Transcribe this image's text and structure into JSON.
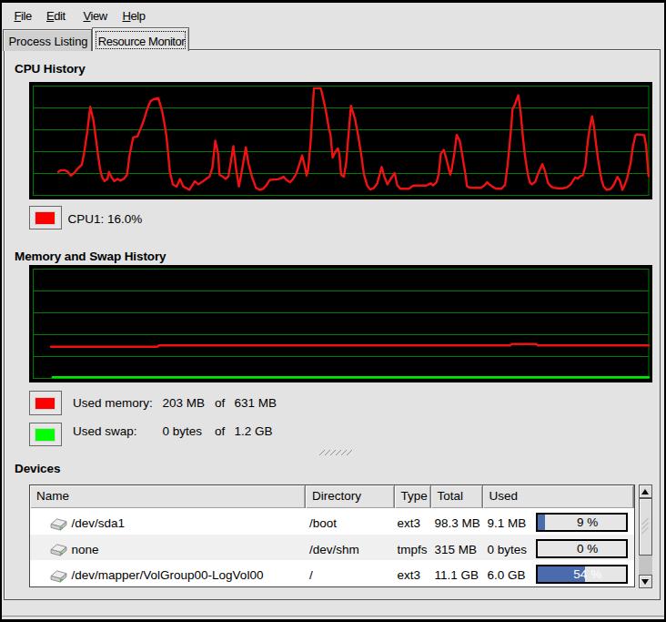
{
  "menu": {
    "items": [
      {
        "label": "File"
      },
      {
        "label": "Edit"
      },
      {
        "label": "View"
      },
      {
        "label": "Help"
      }
    ]
  },
  "tabs": [
    {
      "label": "Process Listing",
      "active": false
    },
    {
      "label": "Resource Monitor",
      "active": true
    }
  ],
  "cpu": {
    "heading": "CPU History",
    "legend": {
      "label": "CPU1:",
      "value": "16.0%",
      "color": "#ff0000"
    }
  },
  "memory": {
    "heading": "Memory and Swap History",
    "legends": [
      {
        "label": "Used memory:",
        "value": "203 MB",
        "of": "of",
        "total": "631 MB",
        "color": "#ff0000"
      },
      {
        "label": "Used swap:",
        "value": "0 bytes",
        "of": "of",
        "total": "1.2 GB",
        "color": "#00ff00"
      }
    ]
  },
  "devices": {
    "heading": "Devices",
    "columns": [
      {
        "label": "Name"
      },
      {
        "label": "Directory"
      },
      {
        "label": "Type"
      },
      {
        "label": "Total"
      },
      {
        "label": "Used"
      }
    ],
    "rows": [
      {
        "name": "/dev/sda1",
        "directory": "/boot",
        "type": "ext3",
        "total": "98.3 MB",
        "used": "9.1 MB",
        "percent": 9,
        "percent_label": "9 %"
      },
      {
        "name": "none",
        "directory": "/dev/shm",
        "type": "tmpfs",
        "total": "315 MB",
        "used": "0 bytes",
        "percent": 0,
        "percent_label": "0 %"
      },
      {
        "name": "/dev/mapper/VolGroup00-LogVol00",
        "directory": "/",
        "type": "ext3",
        "total": "11.1 GB",
        "used": "6.0 GB",
        "percent": 54,
        "percent_label": "54 %"
      }
    ]
  },
  "icons": {
    "device_row_icon": "harddisk-icon",
    "scrollbar_icons": [
      "scroll-up-icon",
      "scroll-down-icon"
    ],
    "grip_icon": "pane-resize-grip"
  },
  "colors": {
    "window_bg": "#dcdcdc",
    "chart_bg": "#000000",
    "grid_green": "#007d00",
    "cpu_line": "#f01212",
    "mem_line": "#f01212",
    "swap_line": "#00e800",
    "progress_blue": "#4a6cad",
    "alt_row": "#efefef"
  },
  "chart_data": [
    {
      "type": "line",
      "title": "CPU History",
      "xlabel": "",
      "ylabel": "",
      "ylim": [
        0,
        100
      ],
      "grid": true,
      "h_gridlines": 4,
      "grid_color": "#007d00",
      "bg": "#000000",
      "legend_position": "below",
      "series": [
        {
          "name": "CPU1",
          "color": "#f01212",
          "width": 2.4,
          "current_value_label": "16.0%",
          "points": [
            [
              0.0406,
              21.5
            ],
            [
              0.045,
              23
            ],
            [
              0.0509,
              23
            ],
            [
              0.0554,
              22
            ],
            [
              0.0613,
              18
            ],
            [
              0.0657,
              20
            ],
            [
              0.0731,
              25
            ],
            [
              0.079,
              28
            ],
            [
              0.0825,
              38
            ],
            [
              0.0878,
              58
            ],
            [
              0.0927,
              81
            ],
            [
              0.0977,
              69
            ],
            [
              0.1007,
              57
            ],
            [
              0.1051,
              38
            ],
            [
              0.1086,
              24
            ],
            [
              0.1116,
              17
            ],
            [
              0.1159,
              13
            ],
            [
              0.1206,
              15
            ],
            [
              0.1232,
              21.5
            ],
            [
              0.1268,
              17
            ],
            [
              0.1315,
              13
            ],
            [
              0.137,
              15
            ],
            [
              0.1413,
              13.5
            ],
            [
              0.1472,
              15
            ],
            [
              0.1525,
              19
            ],
            [
              0.1569,
              38
            ],
            [
              0.1624,
              53
            ],
            [
              0.1696,
              54
            ],
            [
              0.1714,
              57
            ],
            [
              0.1751,
              62
            ],
            [
              0.1805,
              70
            ],
            [
              0.1858,
              80
            ],
            [
              0.1906,
              86
            ],
            [
              0.1956,
              88
            ],
            [
              0.2032,
              89
            ],
            [
              0.2094,
              77
            ],
            [
              0.2131,
              66
            ],
            [
              0.2167,
              53
            ],
            [
              0.2221,
              21
            ],
            [
              0.2269,
              10
            ],
            [
              0.2331,
              8
            ],
            [
              0.2385,
              15
            ],
            [
              0.244,
              8
            ],
            [
              0.2493,
              6.5
            ],
            [
              0.2537,
              5
            ],
            [
              0.2627,
              13
            ],
            [
              0.2682,
              10
            ],
            [
              0.2737,
              12
            ],
            [
              0.2809,
              15
            ],
            [
              0.2863,
              17
            ],
            [
              0.2911,
              25
            ],
            [
              0.2958,
              50
            ],
            [
              0.3005,
              38
            ],
            [
              0.3026,
              19
            ],
            [
              0.308,
              17
            ],
            [
              0.3125,
              15
            ],
            [
              0.3172,
              17.5
            ],
            [
              0.3252,
              45
            ],
            [
              0.3299,
              23
            ],
            [
              0.3342,
              8
            ],
            [
              0.3379,
              19
            ],
            [
              0.3454,
              44
            ],
            [
              0.3498,
              29
            ],
            [
              0.3553,
              17
            ],
            [
              0.3618,
              7
            ],
            [
              0.368,
              5
            ],
            [
              0.3734,
              6
            ],
            [
              0.3787,
              9
            ],
            [
              0.3842,
              14
            ],
            [
              0.3897,
              14.5
            ],
            [
              0.3951,
              14.5
            ],
            [
              0.4024,
              15.5
            ],
            [
              0.4068,
              17
            ],
            [
              0.4115,
              14
            ],
            [
              0.417,
              12
            ],
            [
              0.4223,
              15
            ],
            [
              0.4277,
              20
            ],
            [
              0.4369,
              36.5
            ],
            [
              0.4415,
              26
            ],
            [
              0.4441,
              18
            ],
            [
              0.4466,
              23
            ],
            [
              0.4509,
              50
            ],
            [
              0.4539,
              80
            ],
            [
              0.4561,
              98
            ],
            [
              0.467,
              98
            ],
            [
              0.4695,
              93
            ],
            [
              0.475,
              79
            ],
            [
              0.4804,
              61
            ],
            [
              0.483,
              56
            ],
            [
              0.4852,
              42
            ],
            [
              0.4865,
              34.5
            ],
            [
              0.4912,
              40
            ],
            [
              0.4949,
              43
            ],
            [
              0.4974,
              38
            ],
            [
              0.5002,
              19
            ],
            [
              0.5046,
              17
            ],
            [
              0.5085,
              30
            ],
            [
              0.5129,
              60
            ],
            [
              0.5162,
              82
            ],
            [
              0.5228,
              70
            ],
            [
              0.5281,
              54
            ],
            [
              0.5328,
              38
            ],
            [
              0.5373,
              19
            ],
            [
              0.5427,
              9
            ],
            [
              0.5475,
              5.3
            ],
            [
              0.5535,
              6.7
            ],
            [
              0.559,
              11
            ],
            [
              0.5662,
              26
            ],
            [
              0.5706,
              17
            ],
            [
              0.5754,
              10
            ],
            [
              0.5808,
              15
            ],
            [
              0.5873,
              20.5
            ],
            [
              0.5916,
              9
            ],
            [
              0.597,
              6
            ],
            [
              0.603,
              6
            ],
            [
              0.6103,
              6
            ],
            [
              0.6177,
              9
            ],
            [
              0.6251,
              9
            ],
            [
              0.6316,
              9
            ],
            [
              0.6388,
              9
            ],
            [
              0.6461,
              11
            ],
            [
              0.6496,
              9
            ],
            [
              0.6551,
              12
            ],
            [
              0.6587,
              19
            ],
            [
              0.6623,
              38
            ],
            [
              0.6669,
              41.6
            ],
            [
              0.6722,
              31.5
            ],
            [
              0.6775,
              18.9
            ],
            [
              0.6797,
              23
            ],
            [
              0.6841,
              38
            ],
            [
              0.688,
              55.3
            ],
            [
              0.693,
              50
            ],
            [
              0.6968,
              37.6
            ],
            [
              0.7023,
              19
            ],
            [
              0.7046,
              8.4
            ],
            [
              0.7092,
              7
            ],
            [
              0.7166,
              6.8
            ],
            [
              0.7274,
              6.8
            ],
            [
              0.7328,
              9
            ],
            [
              0.7374,
              12
            ],
            [
              0.7421,
              9.5
            ],
            [
              0.7473,
              7.6
            ],
            [
              0.7523,
              6
            ],
            [
              0.7604,
              6
            ],
            [
              0.7666,
              9.5
            ],
            [
              0.7706,
              26.9
            ],
            [
              0.7739,
              45.4
            ],
            [
              0.7768,
              63.9
            ],
            [
              0.7787,
              78.9
            ],
            [
              0.7821,
              82.4
            ],
            [
              0.7849,
              87
            ],
            [
              0.7882,
              91.7
            ],
            [
              0.7919,
              76.6
            ],
            [
              0.7959,
              52
            ],
            [
              0.7987,
              37.5
            ],
            [
              0.8016,
              26.2
            ],
            [
              0.8044,
              17.3
            ],
            [
              0.8072,
              11.6
            ],
            [
              0.81,
              10
            ],
            [
              0.8158,
              12.5
            ],
            [
              0.8201,
              19.7
            ],
            [
              0.8272,
              28.6
            ],
            [
              0.8317,
              22
            ],
            [
              0.8362,
              11.5
            ],
            [
              0.8406,
              8.4
            ],
            [
              0.845,
              7
            ],
            [
              0.8524,
              6.5
            ],
            [
              0.8604,
              6.5
            ],
            [
              0.8664,
              7.2
            ],
            [
              0.8726,
              9.5
            ],
            [
              0.8766,
              13
            ],
            [
              0.8807,
              16.5
            ],
            [
              0.8849,
              15.3
            ],
            [
              0.8889,
              17.7
            ],
            [
              0.893,
              18.2
            ],
            [
              0.8971,
              26.9
            ],
            [
              0.9011,
              50
            ],
            [
              0.9045,
              62.7
            ],
            [
              0.908,
              72.4
            ],
            [
              0.9114,
              61.5
            ],
            [
              0.9142,
              47.7
            ],
            [
              0.9175,
              33.8
            ],
            [
              0.9207,
              22.2
            ],
            [
              0.9235,
              14.2
            ],
            [
              0.9265,
              8.4
            ],
            [
              0.9317,
              4.9
            ],
            [
              0.9379,
              6
            ],
            [
              0.942,
              8.4
            ],
            [
              0.946,
              13
            ],
            [
              0.9492,
              16.9
            ],
            [
              0.9534,
              13
            ],
            [
              0.9573,
              4.9
            ],
            [
              0.9601,
              8.4
            ],
            [
              0.9646,
              15
            ],
            [
              0.9705,
              29.2
            ],
            [
              0.9746,
              45.4
            ],
            [
              0.9786,
              55.1
            ],
            [
              0.9807,
              55.8
            ],
            [
              0.9867,
              55.5
            ],
            [
              0.9926,
              55
            ],
            [
              0.9957,
              45.4
            ],
            [
              0.9981,
              29.2
            ],
            [
              0.9997,
              17.6
            ]
          ]
        }
      ]
    },
    {
      "type": "line",
      "title": "Memory and Swap History",
      "xlabel": "",
      "ylabel": "",
      "ylim": [
        0,
        100
      ],
      "grid": true,
      "h_gridlines": 4,
      "grid_color": "#007d00",
      "bg": "#000000",
      "legend_position": "below",
      "series": [
        {
          "name": "Used memory",
          "color": "#f01212",
          "width": 2.4,
          "current_value_label": "203 MB of 631 MB",
          "points": [
            [
              0.0288,
              29.0
            ],
            [
              0.2015,
              29.0
            ],
            [
              0.2044,
              30.2
            ],
            [
              0.7749,
              30.2
            ],
            [
              0.7779,
              31.4
            ],
            [
              0.817,
              31.4
            ],
            [
              0.8199,
              30.2
            ],
            [
              1.0,
              30.2
            ]
          ]
        },
        {
          "name": "Used swap",
          "color": "#00e800",
          "width": 2.4,
          "current_value_label": "0 bytes of 1.2 GB",
          "points": [
            [
              0.0317,
              1.0
            ],
            [
              1.0,
              1.0
            ]
          ]
        }
      ]
    }
  ]
}
